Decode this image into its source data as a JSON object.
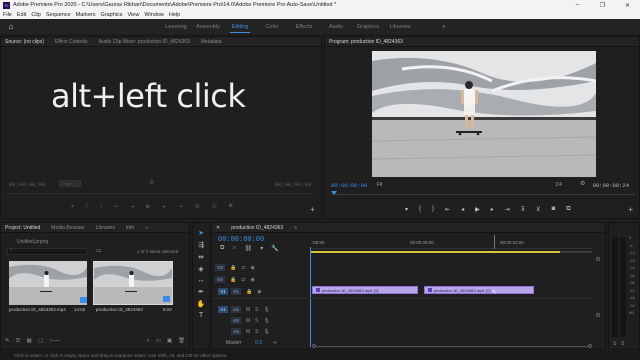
{
  "window": {
    "title": "Adobe Premiere Pro 2020 - C:\\Users\\Gaurav Rikhari\\Documents\\Adobe\\Premiere Pro\\14.0\\Adobe Premiere Pro Auto-Save\\Untitled *"
  },
  "menu": [
    "File",
    "Edit",
    "Clip",
    "Sequence",
    "Markers",
    "Graphics",
    "View",
    "Window",
    "Help"
  ],
  "workspaces": {
    "tabs": [
      "Learning",
      "Assembly",
      "Editing",
      "Color",
      "Effects",
      "Audio",
      "Graphics",
      "Libraries"
    ],
    "active": "Editing",
    "more": "»"
  },
  "source_panel": {
    "tabs": [
      "Source: (no clips)",
      "Effect Controls",
      "Audio Clip Mixer: production ID_4824363",
      "Metadata"
    ],
    "overlay_text": "alt+left click",
    "tc_left": "00;00;00;00",
    "tc_right": "00;00;00;00",
    "page": "Page 1"
  },
  "program_panel": {
    "tab": "Program: production ID_4824363",
    "tc_left": "00:00:00:00",
    "fit": "Fit",
    "ratio": "1/4",
    "tc_right": "00:00:09:24"
  },
  "project_panel": {
    "tabs": [
      "Project: Untitled",
      "Media Browser",
      "Libraries",
      "Info"
    ],
    "file": "Untitled.prproj",
    "selection": "1 of 2 items selected",
    "items": [
      {
        "name": "production ID_4824363.mp4",
        "duration": "14:02"
      },
      {
        "name": "production ID_4824363",
        "duration": "9:24"
      }
    ]
  },
  "timeline": {
    "tab": "production ID_4824363",
    "timecode": "00:00:00:00",
    "ruler": [
      ":00:00",
      "00:00:05:00",
      "00:00:10:00"
    ],
    "tracks": [
      {
        "id": "V3",
        "label": "V3"
      },
      {
        "id": "V2",
        "label": "V2"
      },
      {
        "id": "V1",
        "label": "V1",
        "src": "V1"
      },
      {
        "id": "A1",
        "label": "A1",
        "src": "A1",
        "m": "M",
        "s": "S"
      },
      {
        "id": "A2",
        "label": "A2",
        "m": "M",
        "s": "S"
      },
      {
        "id": "A3",
        "label": "A3",
        "m": "M",
        "s": "S"
      }
    ],
    "master_label": "Master",
    "master_value": "0.0",
    "clips": [
      {
        "name": "production ID_4824363.mp4 [V]"
      },
      {
        "name": "production ID_4824363.mp4 [V]"
      }
    ]
  },
  "status": "Click to select, or click in empty space and drag to marquee select. Use Shift, Alt, and Ctrl for other options.",
  "meter": {
    "labels": [
      "0",
      "-6",
      "-12",
      "-18",
      "-24",
      "-30",
      "-36",
      "-42",
      "-48",
      "-54",
      "dB"
    ],
    "solo": "S",
    "solo2": "S"
  },
  "accent": "#3b8ce8",
  "clip_color": "#b8a4e8"
}
